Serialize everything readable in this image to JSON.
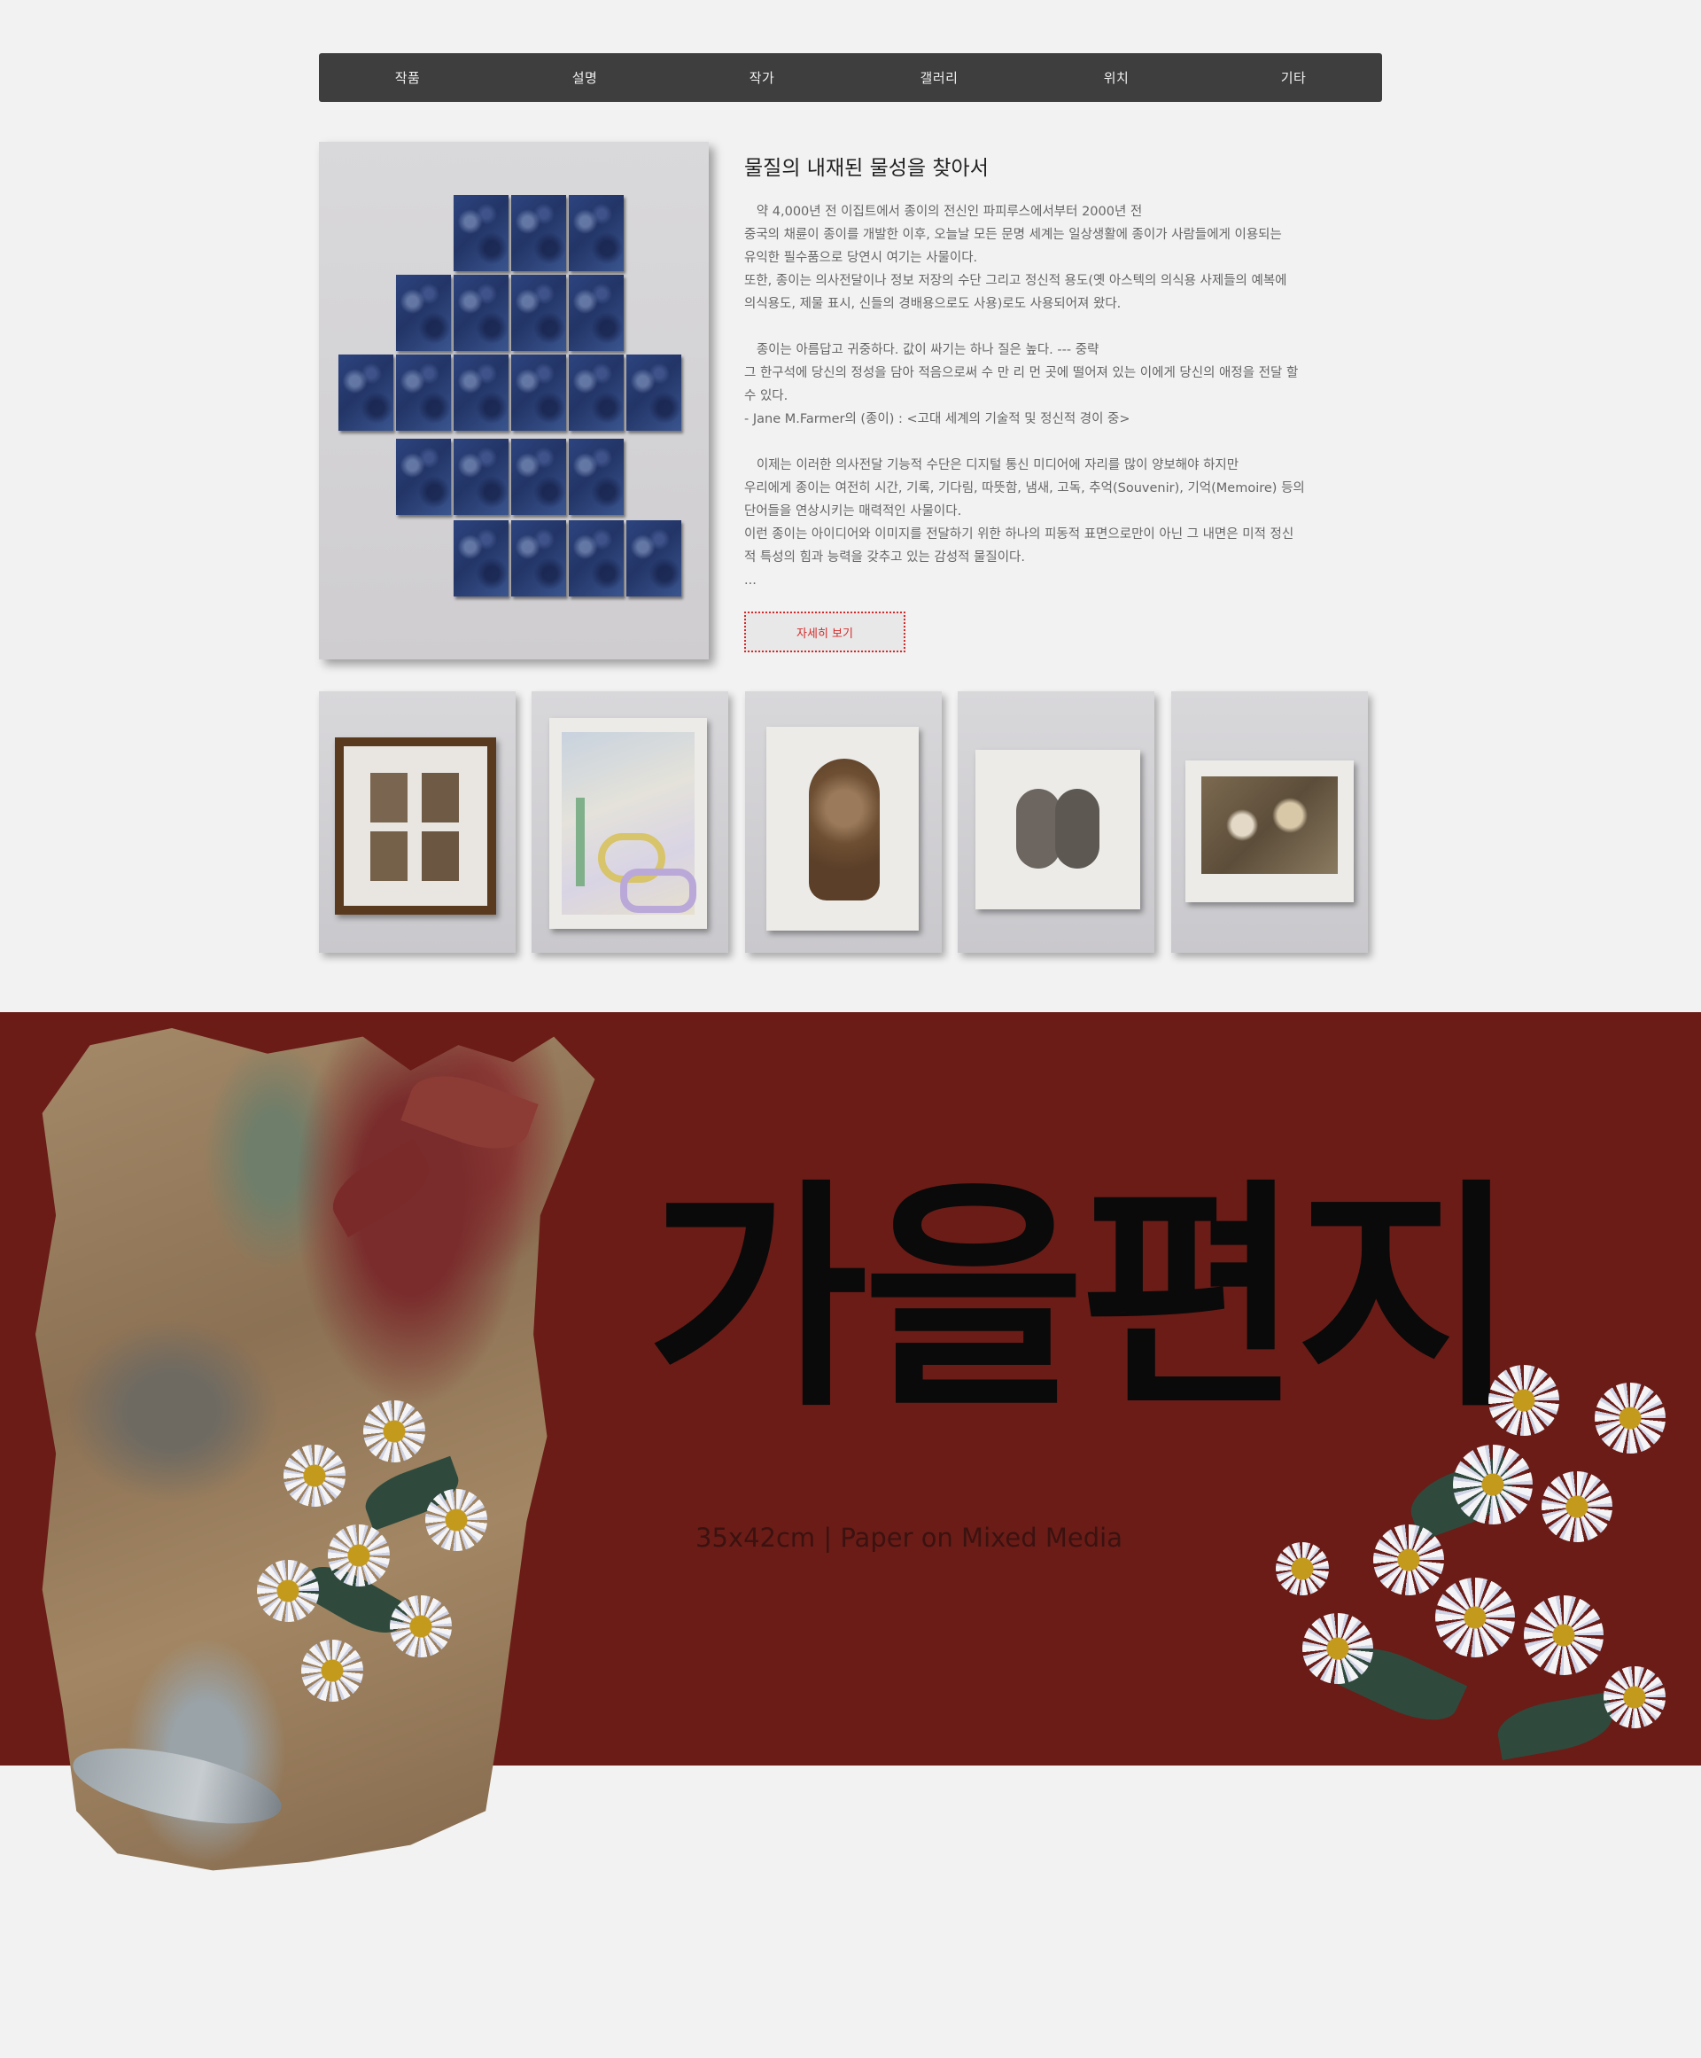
{
  "nav": {
    "items": [
      "작품",
      "설명",
      "작가",
      "갤러리",
      "위치",
      "기타"
    ]
  },
  "feature": {
    "image_alt": "blue paper tiles artwork",
    "title": "물질의 내재된 물성을 찾아서",
    "paragraphs": [
      "   약 4,000년 전 이집트에서 종이의 전신인 파피루스에서부터 2000년 전",
      "중국의 채륜이 종이를 개발한 이후, 오늘날 모든 문명 세계는 일상생활에 종이가 사람들에게 이용되는",
      "유익한 필수품으로 당연시 여기는 사물이다.",
      "또한, 종이는 의사전달이나 정보 저장의 수단 그리고 정신적 용도(옛 아스텍의 의식용 사제들의 예복에",
      "의식용도, 제물 표시, 신들의 경배용으로도 사용)로도 사용되어져 왔다.",
      "",
      "   종이는 아름답고 귀중하다. 값이 싸기는 하나 질은 높다. --- 중략",
      "그 한구석에 당신의 정성을 담아 적음으로써 수 만 리 먼 곳에 떨어져 있는 이에게 당신의 애정을 전달 할",
      "수 있다.",
      "- Jane M.Farmer의 (종이) : <고대 세계의 기술적 및 정신적 경이 중>",
      "",
      "   이제는 이러한 의사전달 기능적 수단은 디지털 통신 미디어에 자리를 많이 양보해야 하지만",
      "우리에게 종이는 여전히 시간, 기록, 기다림, 따뜻함, 냄새, 고독, 추억(Souvenir), 기억(Memoire) 등의",
      "단어들을 연상시키는 매력적인 사물이다.",
      "이런 종이는 아이디어와 이미지를 전달하기 위한 하나의 피동적 표면으로만이 아닌 그 내면은 미적 정신",
      "적 특성의 힘과 능력을 갖추고 있는 감성적 물질이다.",
      "..."
    ],
    "more_button": "자세히 보기"
  },
  "thumbnails": [
    {
      "name": "framed four panels"
    },
    {
      "name": "letters on paper"
    },
    {
      "name": "brown figure relief"
    },
    {
      "name": "two figures relief"
    },
    {
      "name": "textured landscape"
    }
  ],
  "banner": {
    "title": "가을편지",
    "subtitle": "35x42cm | Paper on Mixed Media",
    "background_color": "#6b1c17"
  },
  "colors": {
    "nav_bg": "#3e3e3e",
    "accent_red": "#d42a2a",
    "page_bg": "#f2f2f2"
  }
}
